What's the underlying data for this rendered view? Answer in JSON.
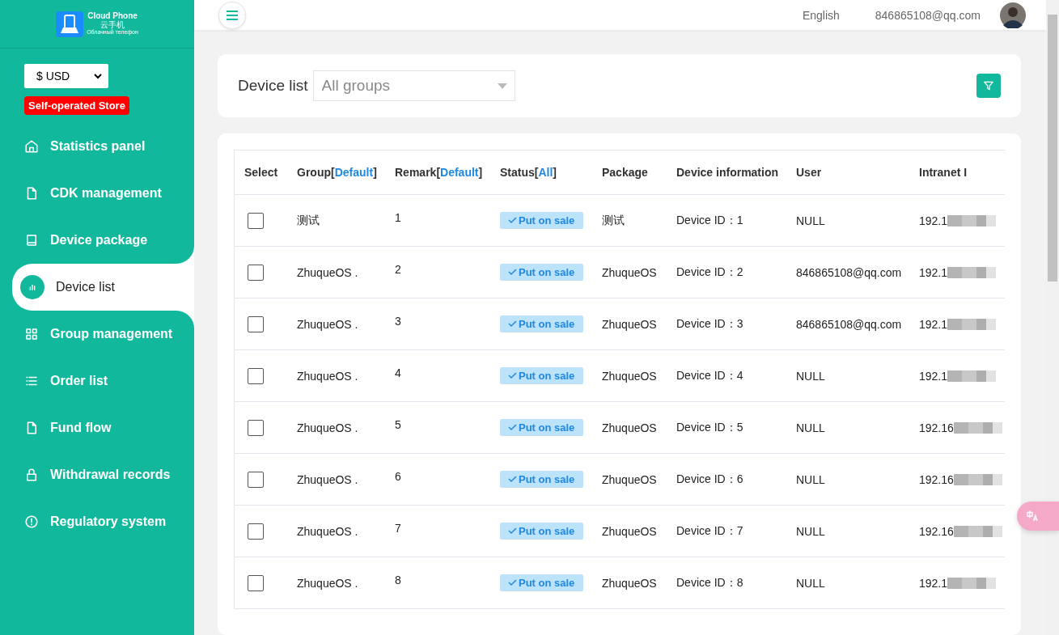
{
  "logo": {
    "title": "Cloud Phone",
    "subtitle_cn": "云手机",
    "subtitle_ru": "Облачный телефон"
  },
  "currency": {
    "value": "$ USD"
  },
  "store_badge": "Self-operated Store",
  "sidebar": {
    "items": [
      {
        "label": "Statistics panel",
        "selected": false
      },
      {
        "label": "CDK management",
        "selected": false
      },
      {
        "label": "Device package",
        "selected": false
      },
      {
        "label": "Device list",
        "selected": true
      },
      {
        "label": "Group management",
        "selected": false
      },
      {
        "label": "Order list",
        "selected": false
      },
      {
        "label": "Fund flow",
        "selected": false
      },
      {
        "label": "Withdrawal records",
        "selected": false
      },
      {
        "label": "Regulatory system",
        "selected": false
      }
    ]
  },
  "header": {
    "language": "English",
    "account": "846865108@qq.com"
  },
  "filter": {
    "label": "Device list",
    "group_placeholder": "All groups"
  },
  "table": {
    "columns": [
      {
        "label": "Select"
      },
      {
        "label": "Group",
        "open": "[",
        "filter": "Default",
        "close": "]"
      },
      {
        "label": "Remark",
        "open": "[",
        "filter": "Default",
        "close": "]"
      },
      {
        "label": "Status",
        "open": "[",
        "filter": "All",
        "close": "]"
      },
      {
        "label": "Package"
      },
      {
        "label": "Device information"
      },
      {
        "label": "User"
      },
      {
        "label": "Intranet I"
      }
    ],
    "rows": [
      {
        "checked": false,
        "group": "测试",
        "remark": "1",
        "status": "Put on sale",
        "package": "测试",
        "device": "Device ID：1",
        "user": "NULL",
        "ip": "192.1"
      },
      {
        "checked": false,
        "group": "ZhuqueOS .",
        "remark": "2",
        "status": "Put on sale",
        "package": "ZhuqueOS",
        "device": "Device ID：2",
        "user": "846865108@qq.com",
        "ip": "192.1"
      },
      {
        "checked": false,
        "group": "ZhuqueOS .",
        "remark": "3",
        "status": "Put on sale",
        "package": "ZhuqueOS",
        "device": "Device ID：3",
        "user": "846865108@qq.com",
        "ip": "192.1"
      },
      {
        "checked": false,
        "group": "ZhuqueOS .",
        "remark": "4",
        "status": "Put on sale",
        "package": "ZhuqueOS",
        "device": "Device ID：4",
        "user": "NULL",
        "ip": "192.1"
      },
      {
        "checked": false,
        "group": "ZhuqueOS .",
        "remark": "5",
        "status": "Put on sale",
        "package": "ZhuqueOS",
        "device": "Device ID：5",
        "user": "NULL",
        "ip": "192.16"
      },
      {
        "checked": false,
        "group": "ZhuqueOS .",
        "remark": "6",
        "status": "Put on sale",
        "package": "ZhuqueOS",
        "device": "Device ID：6",
        "user": "NULL",
        "ip": "192.16"
      },
      {
        "checked": false,
        "group": "ZhuqueOS .",
        "remark": "7",
        "status": "Put on sale",
        "package": "ZhuqueOS",
        "device": "Device ID：7",
        "user": "NULL",
        "ip": "192.16"
      },
      {
        "checked": false,
        "group": "ZhuqueOS .",
        "remark": "8",
        "status": "Put on sale",
        "package": "ZhuqueOS",
        "device": "Device ID：8",
        "user": "NULL",
        "ip": "192.1"
      }
    ]
  }
}
